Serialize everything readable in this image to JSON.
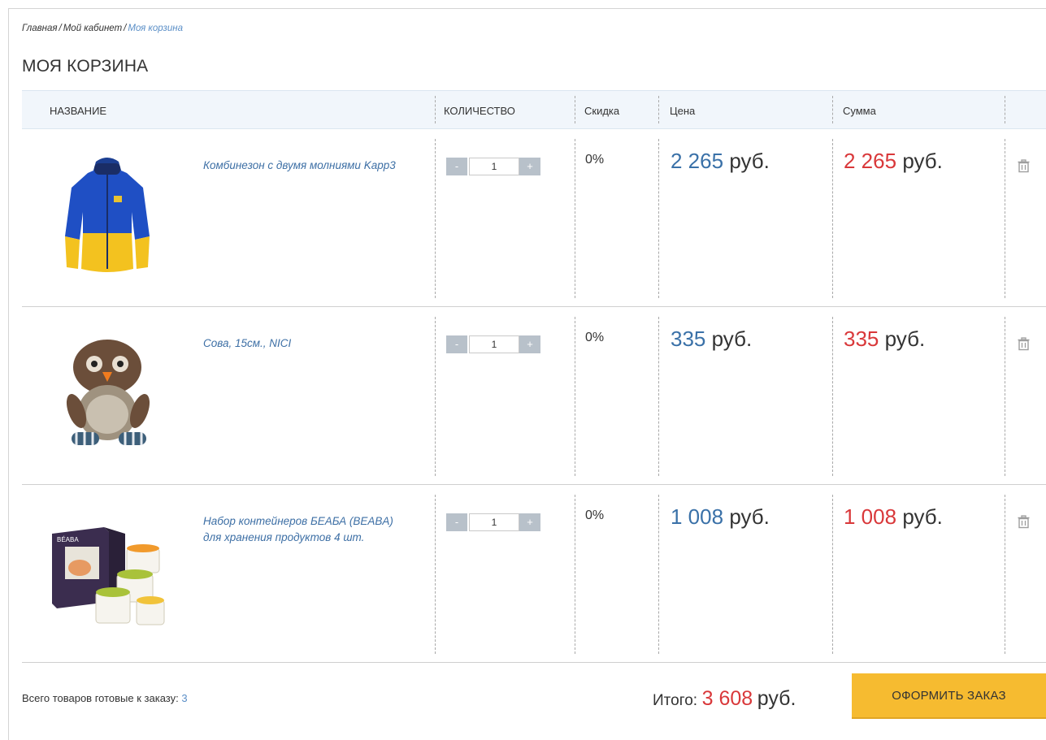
{
  "breadcrumb": {
    "home": "Главная",
    "cabinet": "Мой кабинет",
    "current": "Моя корзина",
    "sep": "/"
  },
  "page_title": "МОЯ КОРЗИНА",
  "table_headers": {
    "name": "НАЗВАНИЕ",
    "quantity": "КОЛИЧЕСТВО",
    "discount": "Скидка",
    "price": "Цена",
    "sum": "Сумма"
  },
  "items": [
    {
      "name": "Комбинезон с двумя молниями Kapp3",
      "quantity": "1",
      "discount": "0%",
      "price": "2 265",
      "sum": "2 265",
      "currency": "руб.",
      "image_icon": "jacket-image"
    },
    {
      "name": "Сова, 15см., NICI",
      "quantity": "1",
      "discount": "0%",
      "price": "335",
      "sum": "335",
      "currency": "руб.",
      "image_icon": "owl-toy-image"
    },
    {
      "name": "Набор контейнеров БЕАБА (BEABA) для хранения продуктов 4 шт.",
      "quantity": "1",
      "discount": "0%",
      "price": "1 008",
      "sum": "1 008",
      "currency": "руб.",
      "image_icon": "containers-image"
    }
  ],
  "qty_controls": {
    "minus": "-",
    "plus": "+"
  },
  "footer": {
    "ready_label": "Всего товаров готовые к заказу:",
    "ready_count": "3",
    "total_label": "Итого:",
    "total_value": "3 608",
    "total_currency": "руб.",
    "order_button": "ОФОРМИТЬ ЗАКАЗ"
  },
  "colors": {
    "accent_blue": "#3a71a8",
    "price_red": "#d9383a",
    "link_blue": "#5b8fc7",
    "order_button": "#f6bb30",
    "header_bg": "#f1f6fb"
  }
}
